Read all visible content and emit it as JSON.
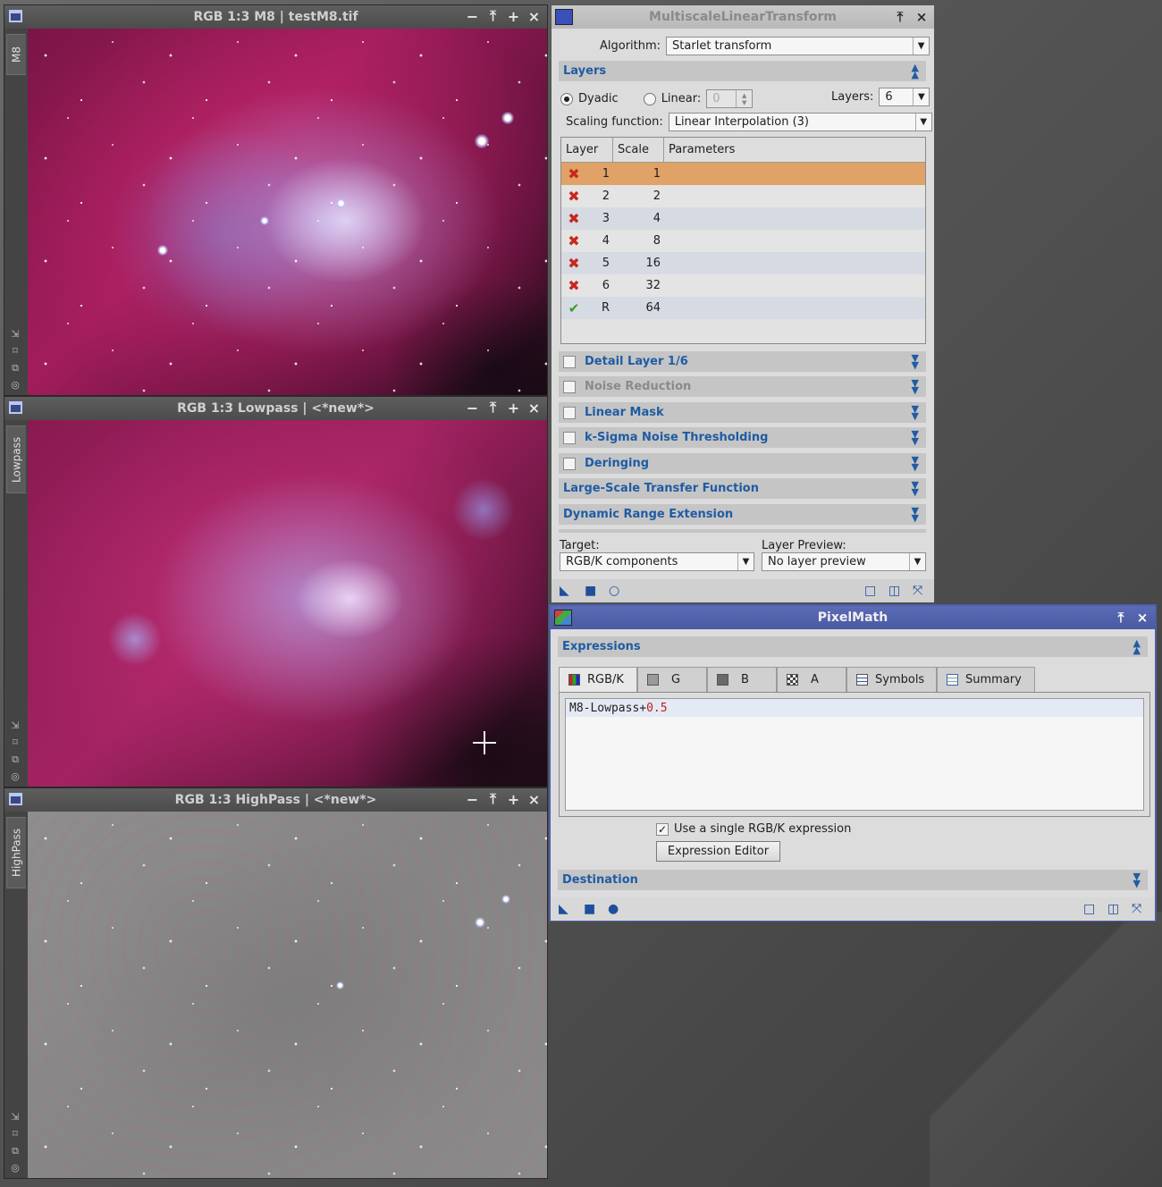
{
  "image_windows": [
    {
      "title": "RGB 1:3 M8 | testM8.tif",
      "side_label": "M8"
    },
    {
      "title": "RGB 1:3 Lowpass | <*new*>",
      "side_label": "Lowpass"
    },
    {
      "title": "RGB 1:3 HighPass | <*new*>",
      "side_label": "HighPass"
    }
  ],
  "mlt": {
    "title": "MultiscaleLinearTransform",
    "algorithm_label": "Algorithm:",
    "algorithm_value": "Starlet transform",
    "layers_section": "Layers",
    "dyadic_label": "Dyadic",
    "linear_label": "Linear:",
    "linear_value": "0",
    "layers_label": "Layers:",
    "layers_value": "6",
    "scaling_label": "Scaling function:",
    "scaling_value": "Linear Interpolation (3)",
    "table": {
      "headers": [
        "Layer",
        "Scale",
        "Parameters"
      ],
      "rows": [
        {
          "status": "disabled",
          "layer": "1",
          "scale": "1"
        },
        {
          "status": "disabled",
          "layer": "2",
          "scale": "2"
        },
        {
          "status": "disabled",
          "layer": "3",
          "scale": "4"
        },
        {
          "status": "disabled",
          "layer": "4",
          "scale": "8"
        },
        {
          "status": "disabled",
          "layer": "5",
          "scale": "16"
        },
        {
          "status": "disabled",
          "layer": "6",
          "scale": "32"
        },
        {
          "status": "enabled",
          "layer": "R",
          "scale": "64"
        }
      ]
    },
    "sections": {
      "detail": "Detail Layer 1/6",
      "noise": "Noise Reduction",
      "linear_mask": "Linear Mask",
      "ksigma": "k-Sigma Noise Thresholding",
      "deringing": "Deringing",
      "large_scale": "Large-Scale Transfer Function",
      "dre": "Dynamic Range Extension"
    },
    "target_label": "Target:",
    "target_value": "RGB/K components",
    "preview_label": "Layer Preview:",
    "preview_value": "No layer preview"
  },
  "pixelmath": {
    "title": "PixelMath",
    "expressions_section": "Expressions",
    "tabs": [
      "RGB/K",
      "G",
      "B",
      "A",
      "Symbols",
      "Summary"
    ],
    "expr_text": "M8-Lowpass+",
    "expr_number": "0.5",
    "single_expr_label": "Use a single RGB/K expression",
    "editor_button": "Expression Editor",
    "destination_section": "Destination"
  }
}
